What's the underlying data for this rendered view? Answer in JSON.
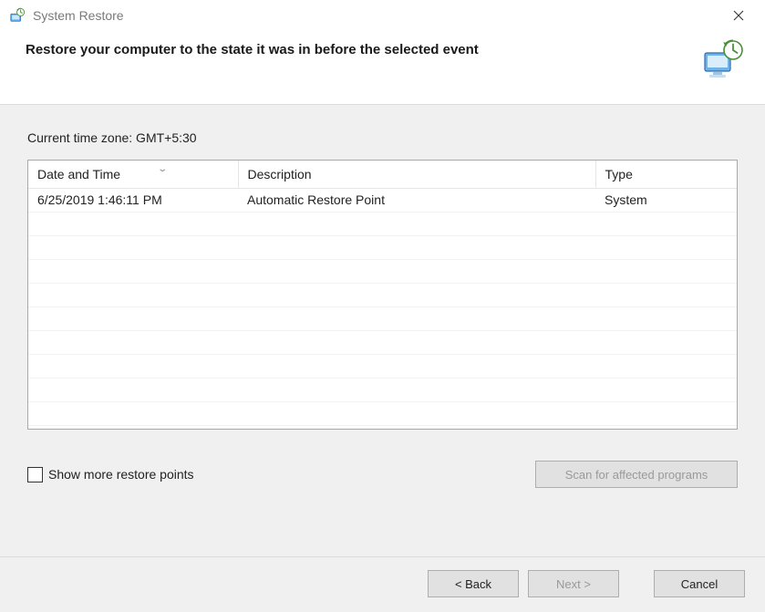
{
  "titlebar": {
    "title": "System Restore"
  },
  "header": {
    "headline": "Restore your computer to the state it was in before the selected event"
  },
  "body": {
    "timezone_label": "Current time zone: GMT+5:30",
    "columns": {
      "datetime": "Date and Time",
      "description": "Description",
      "type": "Type"
    },
    "rows": [
      {
        "datetime": "6/25/2019 1:46:11 PM",
        "description": "Automatic Restore Point",
        "type": "System"
      }
    ],
    "show_more_label": "Show more restore points",
    "scan_label": "Scan for affected programs"
  },
  "footer": {
    "back": "< Back",
    "next": "Next >",
    "cancel": "Cancel"
  }
}
